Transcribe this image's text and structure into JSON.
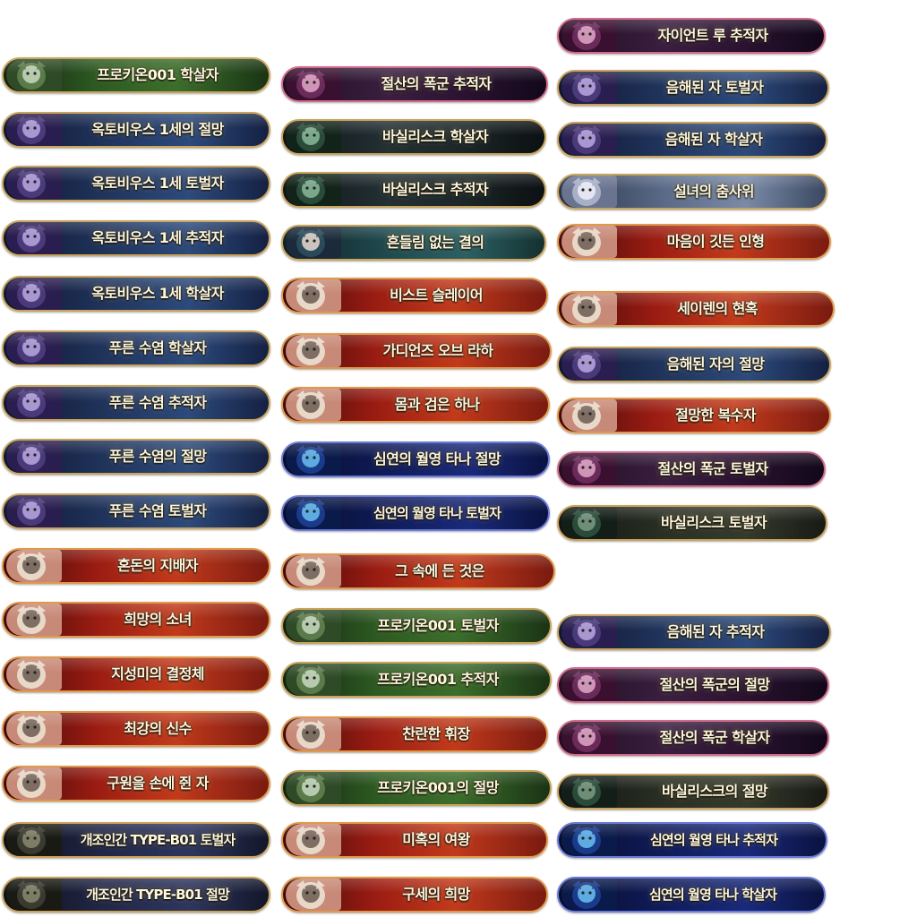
{
  "columns": [
    {
      "badges": [
        {
          "label": "프로키온001 학살자",
          "theme": "green",
          "icon": "mech-ship-icon"
        },
        {
          "label": "옥토비우스 1세의 절망",
          "theme": "blue",
          "icon": "octopus-boss-icon"
        },
        {
          "label": "옥토비우스 1세 토벌자",
          "theme": "blue",
          "icon": "octopus-boss-icon"
        },
        {
          "label": "옥토비우스 1세 추적자",
          "theme": "blue",
          "icon": "octopus-boss-icon"
        },
        {
          "label": "옥토비우스 1세 학살자",
          "theme": "blue",
          "icon": "octopus-boss-icon"
        },
        {
          "label": "푸른 수염 학살자",
          "theme": "blue",
          "icon": "bluebeard-boss-icon"
        },
        {
          "label": "푸른 수염 추적자",
          "theme": "blue",
          "icon": "bluebeard-boss-icon"
        },
        {
          "label": "푸른 수염의 절망",
          "theme": "blue",
          "icon": "bluebeard-boss-icon"
        },
        {
          "label": "푸른 수염 토벌자",
          "theme": "blue",
          "icon": "bluebeard-boss-icon"
        },
        {
          "label": "혼돈의 지배자",
          "theme": "red",
          "icon": "demon-portrait-icon"
        },
        {
          "label": "희망의 소녀",
          "theme": "red",
          "icon": "girl-portrait-icon"
        },
        {
          "label": "지성미의 결정체",
          "theme": "red",
          "icon": "girl-portrait-icon"
        },
        {
          "label": "최강의 신수",
          "theme": "red",
          "icon": "beast-girl-portrait-icon"
        },
        {
          "label": "구원을 손에 쥔 자",
          "theme": "red",
          "icon": "girl-portrait-icon"
        },
        {
          "label": "개조인간 TYPE-B01 토벌자",
          "theme": "mech",
          "icon": "cyborg-boss-icon"
        },
        {
          "label": "개조인간 TYPE-B01 절망",
          "theme": "mech",
          "icon": "cyborg-boss-icon"
        }
      ]
    },
    {
      "badges": [
        {
          "label": "절산의 폭군 추적자",
          "theme": "purple",
          "icon": "tyrant-boss-icon"
        },
        {
          "label": "바실리스크 학살자",
          "theme": "dark",
          "icon": "basilisk-boss-icon"
        },
        {
          "label": "바실리스크 추적자",
          "theme": "dark",
          "icon": "basilisk-boss-icon"
        },
        {
          "label": "흔들림 없는 결의",
          "theme": "teal",
          "icon": "girl-portrait-icon"
        },
        {
          "label": "비스트 슬레이어",
          "theme": "red",
          "icon": "girl-portrait-icon"
        },
        {
          "label": "가디언즈 오브 라하",
          "theme": "red",
          "icon": "girl-portrait-icon"
        },
        {
          "label": "몸과 검은 하나",
          "theme": "red",
          "icon": "swordswoman-portrait-icon"
        },
        {
          "label": "심연의 월영 타나 절망",
          "theme": "navy",
          "icon": "shadow-beast-boss-icon"
        },
        {
          "label": "심연의 월영 타나 토벌자",
          "theme": "navy",
          "icon": "shadow-beast-boss-icon"
        },
        {
          "label": "그 속에 든 것은",
          "theme": "red",
          "icon": "girl-portrait-icon"
        },
        {
          "label": "프로키온001 토벌자",
          "theme": "green",
          "icon": "mech-ship-icon"
        },
        {
          "label": "프로키온001 추적자",
          "theme": "green",
          "icon": "mech-ship-icon"
        },
        {
          "label": "찬란한 휘장",
          "theme": "red",
          "icon": "girl-portrait-icon"
        },
        {
          "label": "프로키온001의 절망",
          "theme": "green",
          "icon": "mech-ship-icon"
        },
        {
          "label": "미혹의 여왕",
          "theme": "red",
          "icon": "girl-portrait-icon"
        },
        {
          "label": "구세의 희망",
          "theme": "red",
          "icon": "girl-portrait-icon"
        }
      ]
    },
    {
      "badges": [
        {
          "label": "자이언트 루 추적자",
          "theme": "purple",
          "icon": "cat-boss-icon"
        },
        {
          "label": "음해된 자 토벌자",
          "theme": "blue",
          "icon": "masked-boss-icon"
        },
        {
          "label": "음해된 자 학살자",
          "theme": "blue",
          "icon": "masked-boss-icon"
        },
        {
          "label": "설녀의 춤사위",
          "theme": "steel",
          "icon": "snow-woman-icon"
        },
        {
          "label": "마음이 깃든 인형",
          "theme": "red",
          "icon": "doll-portrait-icon"
        },
        {
          "label": "세이렌의 현혹",
          "theme": "red",
          "icon": "siren-portrait-icon"
        },
        {
          "label": "음해된 자의 절망",
          "theme": "blue",
          "icon": "masked-boss-icon"
        },
        {
          "label": "절망한 복수자",
          "theme": "red",
          "icon": "boy-portrait-icon"
        },
        {
          "label": "절산의 폭군 토벌자",
          "theme": "purple",
          "icon": "tyrant-boss-icon"
        },
        {
          "label": "바실리스크 토벌자",
          "theme": "olive",
          "icon": "basilisk-boss-icon"
        },
        {
          "label": "음해된 자 추적자",
          "theme": "blue",
          "icon": "masked-boss-icon"
        },
        {
          "label": "절산의 폭군의 절망",
          "theme": "purple",
          "icon": "tyrant-boss-icon"
        },
        {
          "label": "절산의 폭군 학살자",
          "theme": "purple",
          "icon": "tyrant-boss-icon"
        },
        {
          "label": "바실리스크의 절망",
          "theme": "olive",
          "icon": "basilisk-boss-icon"
        },
        {
          "label": "심연의 월영 타나 추적자",
          "theme": "navy",
          "icon": "shadow-beast-boss-icon"
        },
        {
          "label": "심연의 월영 타나 학살자",
          "theme": "navy",
          "icon": "shadow-beast-boss-icon"
        }
      ]
    }
  ]
}
